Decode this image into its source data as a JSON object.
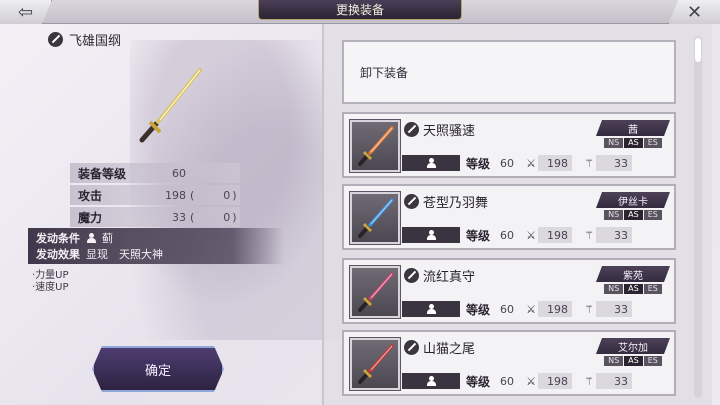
{
  "window": {
    "title": "更换装备"
  },
  "nav": {
    "back_icon": "back-arrow-icon",
    "close_icon": "close-icon"
  },
  "equipment": {
    "name": "飞雄国纲",
    "stats": [
      {
        "label": "装备等级",
        "value": "60",
        "bonus": null
      },
      {
        "label": "攻击",
        "value": "198",
        "bonus": "0"
      },
      {
        "label": "魔力",
        "value": "33",
        "bonus": "0"
      }
    ],
    "skill": {
      "condition_label": "发动条件",
      "condition_value": "蓟",
      "effect_label": "发动效果",
      "effect_value": "显现　天照大神"
    },
    "buffs": [
      "·力量UP",
      "·速度UP"
    ]
  },
  "confirm": {
    "label": "确定"
  },
  "list": {
    "unequip_label": "卸下装备",
    "level_label": "等级",
    "items": [
      {
        "name": "天照骚速",
        "owner": "茜",
        "level": "60",
        "attack": "198",
        "magic": "33",
        "types": [
          "NS",
          "AS",
          "ES"
        ],
        "active_type": "AS",
        "blade_color": "#e07a38"
      },
      {
        "name": "苍型乃羽舞",
        "owner": "伊丝卡",
        "level": "60",
        "attack": "198",
        "magic": "33",
        "types": [
          "NS",
          "AS",
          "ES"
        ],
        "active_type": "AS",
        "blade_color": "#3c8fd8"
      },
      {
        "name": "流红真守",
        "owner": "紫苑",
        "level": "60",
        "attack": "198",
        "magic": "33",
        "types": [
          "NS",
          "AS",
          "ES"
        ],
        "active_type": "AS",
        "blade_color": "#c0456a"
      },
      {
        "name": "山猫之尾",
        "owner": "艾尔加",
        "level": "60",
        "attack": "198",
        "magic": "33",
        "types": [
          "NS",
          "AS",
          "ES"
        ],
        "active_type": "AS",
        "blade_color": "#c03a3a"
      }
    ]
  }
}
